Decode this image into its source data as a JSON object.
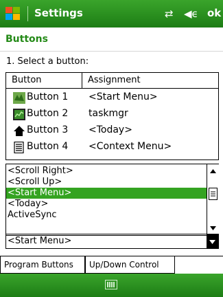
{
  "window": {
    "title": "Settings",
    "ok_label": "ok"
  },
  "section": {
    "label": "Buttons"
  },
  "prompt": "1. Select a button:",
  "table": {
    "columns": [
      "Button",
      "Assignment"
    ],
    "rows": [
      {
        "button": "Button 1",
        "assignment": "<Start Menu>",
        "icon": "start-menu-icon"
      },
      {
        "button": "Button 2",
        "assignment": "taskmgr",
        "icon": "taskmgr-icon"
      },
      {
        "button": "Button 3",
        "assignment": "<Today>",
        "icon": "home-icon"
      },
      {
        "button": "Button 4",
        "assignment": "<Context Menu>",
        "icon": "context-menu-icon"
      }
    ]
  },
  "assign_list": {
    "items": [
      "<Scroll Right>",
      "<Scroll Up>",
      "<Start Menu>",
      "<Today>",
      "ActiveSync"
    ],
    "selected": "<Start Menu>"
  },
  "combo": {
    "value": "<Start Menu>"
  },
  "tabs": [
    "Program Buttons",
    "Up/Down Control"
  ],
  "colors": {
    "accent": "#34a321",
    "titlebar": "#2a9420"
  }
}
